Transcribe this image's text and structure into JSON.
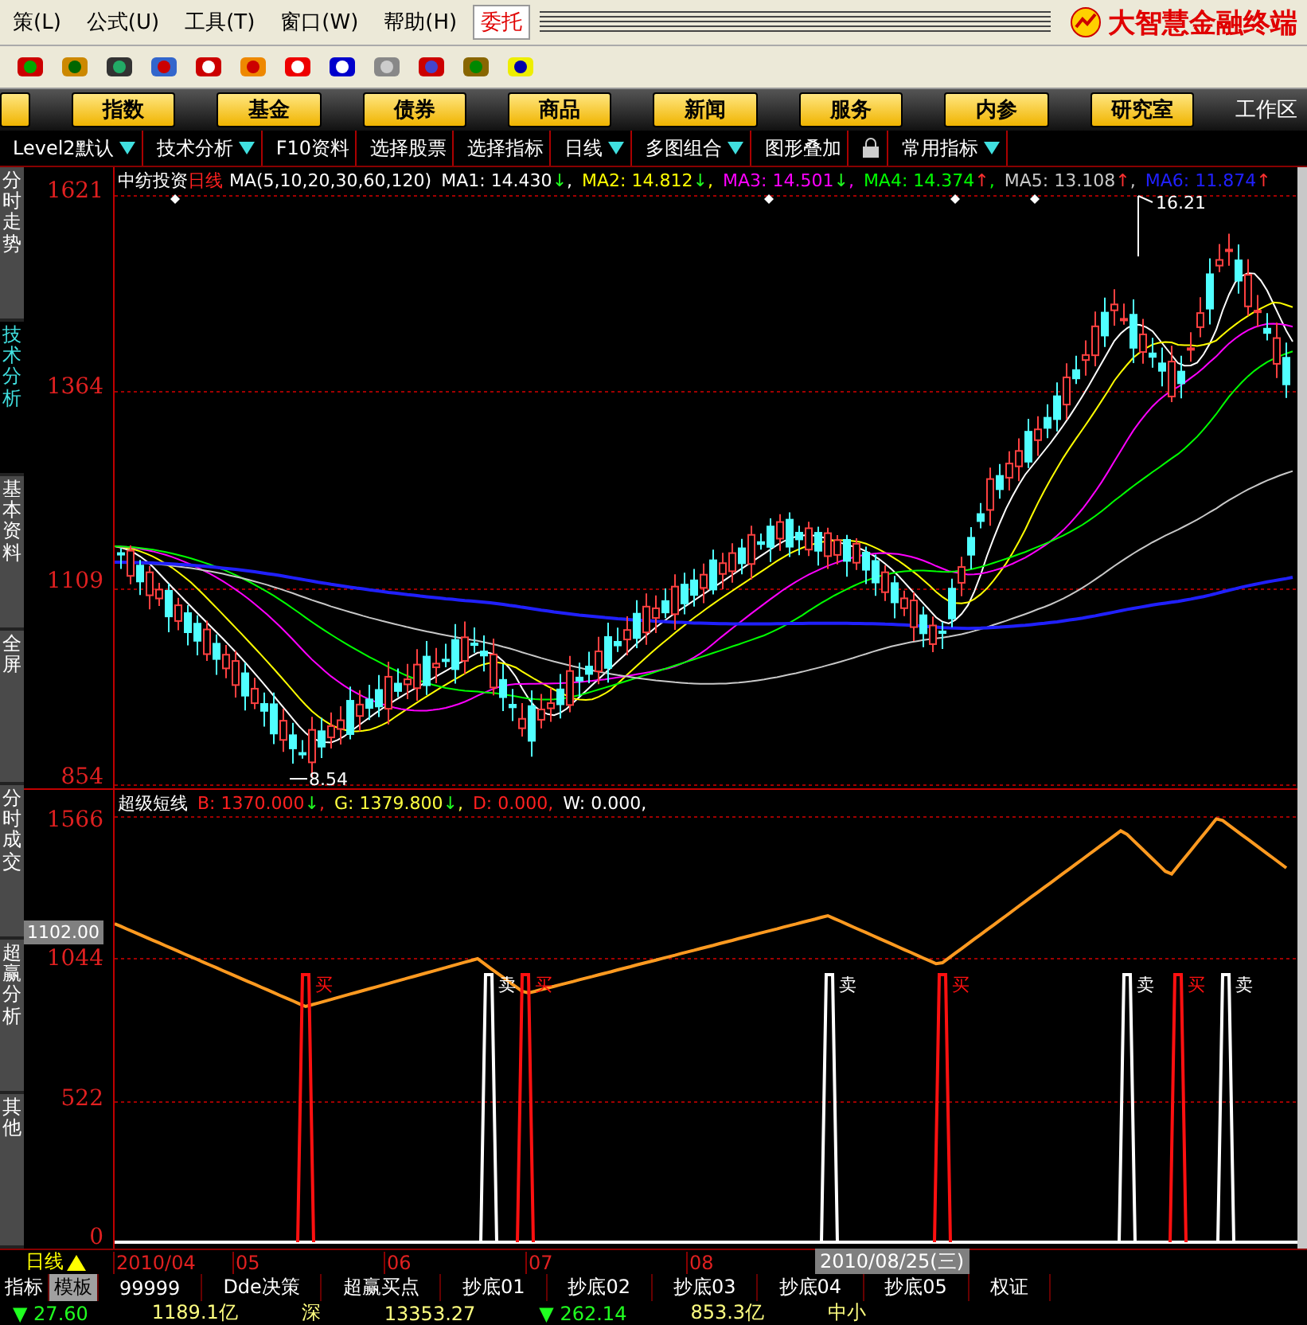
{
  "menu": [
    "策(L)",
    "公式(U)",
    "工具(T)",
    "窗口(W)",
    "帮助(H)"
  ],
  "trade_button": "委托",
  "brand": "大智慧金融终端",
  "nav": [
    "指数",
    "基金",
    "债券",
    "商品",
    "新闻",
    "服务",
    "内参",
    "研究室"
  ],
  "workspace_label": "工作区",
  "function_tabs": [
    {
      "kind": "tab",
      "label": "Level2默认",
      "dropdown": true
    },
    {
      "kind": "tab",
      "label": "技术分析",
      "dropdown": true
    },
    {
      "kind": "tab",
      "label": "F10资料",
      "dropdown": false
    },
    {
      "kind": "tab",
      "label": "选择股票",
      "dropdown": false
    },
    {
      "kind": "tab",
      "label": "选择指标",
      "dropdown": false
    },
    {
      "kind": "tab",
      "label": "日线",
      "dropdown": true
    },
    {
      "kind": "tab",
      "label": "多图组合",
      "dropdown": true
    },
    {
      "kind": "tab",
      "label": "图形叠加",
      "dropdown": false
    },
    {
      "kind": "lock"
    },
    {
      "kind": "tab",
      "label": "常用指标",
      "dropdown": true
    }
  ],
  "sidebar_tabs": [
    {
      "label": "分时走势",
      "selected": false
    },
    {
      "label": "技术分析",
      "selected": true
    },
    {
      "label": "基本资料",
      "selected": false
    },
    {
      "label": "全屏",
      "selected": false
    },
    {
      "label": "分时成交",
      "selected": false
    },
    {
      "label": "超赢分析",
      "selected": false
    },
    {
      "label": "其他",
      "selected": false
    }
  ],
  "price_panel": {
    "stock": "中纺投资",
    "period": "日线",
    "ma_label": "MA(5,10,20,30,60,120)",
    "ma_values": [
      {
        "name": "MA1:",
        "value": "14.430",
        "arrow": "↓",
        "tail": ",",
        "color": "#ffffff"
      },
      {
        "name": "MA2:",
        "value": "14.812",
        "arrow": "↓",
        "tail": ",",
        "color": "#ffff00"
      },
      {
        "name": "MA3:",
        "value": "14.501",
        "arrow": "↓",
        "tail": ",",
        "color": "#ff00ff"
      },
      {
        "name": "MA4:",
        "value": "14.374",
        "arrow": "↑",
        "tail": ",",
        "color": "#00ff00"
      },
      {
        "name": "MA5:",
        "value": "13.108",
        "arrow": "↑",
        "tail": ",",
        "color": "#c8c8c8"
      },
      {
        "name": "MA6:",
        "value": "11.874",
        "arrow": "↑",
        "color": "#2020ff"
      }
    ],
    "y_labels": [
      "1621",
      "1364",
      "1109",
      "854"
    ],
    "high_label": "16.21",
    "low_label": "8.54"
  },
  "indicator_panel": {
    "name": "超级短线",
    "values": [
      {
        "name": "B:",
        "value": "1370.000",
        "arrow": "↓",
        "tail": ",",
        "color": "#ff2020"
      },
      {
        "name": "G:",
        "value": "1379.800",
        "arrow": "↓",
        "tail": ",",
        "color": "#ffff40"
      },
      {
        "name": "D:",
        "value": "0.000",
        "tail": ",",
        "color": "#ff2020"
      },
      {
        "name": "W:",
        "value": "0.000",
        "tail": ",",
        "color": "#ffffff"
      }
    ],
    "y_labels": [
      "1566",
      "1044",
      "522",
      "0"
    ],
    "cursor_label": "1102.00",
    "signals": [
      {
        "kind": "buy",
        "label": "买"
      },
      {
        "kind": "sell",
        "label": "卖"
      },
      {
        "kind": "buy",
        "label": "买"
      },
      {
        "kind": "sell",
        "label": "卖"
      },
      {
        "kind": "buy",
        "label": "买"
      },
      {
        "kind": "sell",
        "label": "卖"
      },
      {
        "kind": "buy",
        "label": "买"
      },
      {
        "kind": "sell",
        "label": "卖"
      }
    ]
  },
  "date_axis": {
    "period": "日线",
    "labels": [
      "2010/04",
      "05",
      "06",
      "07",
      "08"
    ],
    "cursor_date": "2010/08/25(三)"
  },
  "bottom_tabs": [
    {
      "label": "指标",
      "selected": false
    },
    {
      "label": "模板",
      "selected": true
    },
    {
      "label": "99999",
      "selected": false
    },
    {
      "label": "Dde决策",
      "selected": false
    },
    {
      "label": "超赢买点",
      "selected": false
    },
    {
      "label": "抄底01",
      "selected": false
    },
    {
      "label": "抄底02",
      "selected": false
    },
    {
      "label": "抄底03",
      "selected": false
    },
    {
      "label": "抄底04",
      "selected": false
    },
    {
      "label": "抄底05",
      "selected": false
    },
    {
      "label": "权证",
      "selected": false
    }
  ],
  "status": [
    {
      "kind": "down",
      "text": "▼ 27.60"
    },
    {
      "kind": "plain",
      "text": "1189.1亿"
    },
    {
      "kind": "label",
      "text": "深"
    },
    {
      "kind": "plain",
      "text": "13353.27"
    },
    {
      "kind": "down",
      "text": "▼ 262.14"
    },
    {
      "kind": "plain",
      "text": "853.3亿"
    },
    {
      "kind": "label",
      "text": "中小"
    }
  ]
}
